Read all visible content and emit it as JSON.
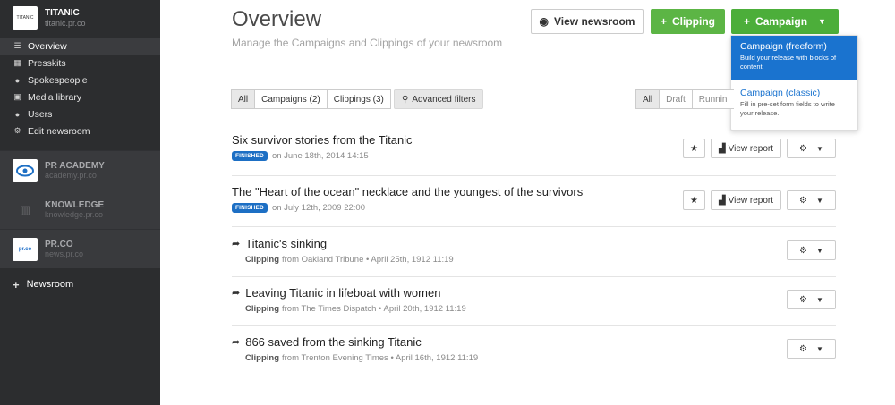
{
  "sidebar": {
    "current": {
      "name": "TITANIC",
      "url": "titanic.pr.co",
      "logo_text": "TITANIC"
    },
    "nav": [
      {
        "label": "Overview",
        "icon": "list-icon",
        "glyph": "☰"
      },
      {
        "label": "Presskits",
        "icon": "grid-icon",
        "glyph": "▦"
      },
      {
        "label": "Spokespeople",
        "icon": "user-icon",
        "glyph": "●"
      },
      {
        "label": "Media library",
        "icon": "image-icon",
        "glyph": "▣"
      },
      {
        "label": "Users",
        "icon": "users-icon",
        "glyph": "●"
      },
      {
        "label": "Edit newsroom",
        "icon": "gear-icon",
        "glyph": "⚙"
      }
    ],
    "others": [
      {
        "name": "PR ACADEMY",
        "url": "academy.pr.co"
      },
      {
        "name": "KNOWLEDGE",
        "url": "knowledge.pr.co"
      },
      {
        "name": "PR.CO",
        "url": "news.pr.co",
        "logo_text": "pr.co"
      }
    ],
    "add_label": "Newsroom"
  },
  "header": {
    "title": "Overview",
    "subtitle": "Manage the Campaigns and Clippings of your newsroom",
    "view_newsroom": "View newsroom",
    "clipping": "Clipping",
    "campaign": "Campaign"
  },
  "dropdown": [
    {
      "title": "Campaign (freeform)",
      "desc": "Build your release with blocks of content."
    },
    {
      "title": "Campaign (classic)",
      "desc": "Fill in pre-set form fields to write your release."
    }
  ],
  "filters": {
    "types": [
      "All",
      "Campaigns (2)",
      "Clippings (3)"
    ],
    "advanced": "Advanced filters",
    "status": [
      "All",
      "Draft",
      "Runnin"
    ]
  },
  "items": [
    {
      "title": "Six survivor stories from the Titanic",
      "badge": "FINISHED",
      "meta": "on June 18th, 2014 14:15",
      "report": "View report"
    },
    {
      "title": "The \"Heart of the ocean\" necklace and the youngest of the survivors",
      "badge": "FINISHED",
      "meta": "on July 12th, 2009 22:00",
      "report": "View report"
    },
    {
      "title": "Titanic's sinking",
      "kind": "Clipping",
      "meta": "from Oakland Tribune • April 25th, 1912 11:19"
    },
    {
      "title": "Leaving Titanic in lifeboat with women",
      "kind": "Clipping",
      "meta": "from The Times Dispatch • April 20th, 1912 11:19"
    },
    {
      "title": "866 saved from the sinking Titanic",
      "kind": "Clipping",
      "meta": "from Trenton Evening Times • April 16th, 1912 11:19"
    }
  ],
  "colors": {
    "sidebar": "#2c2d2f",
    "green": "#4cae3a",
    "blue": "#1a73cf"
  }
}
